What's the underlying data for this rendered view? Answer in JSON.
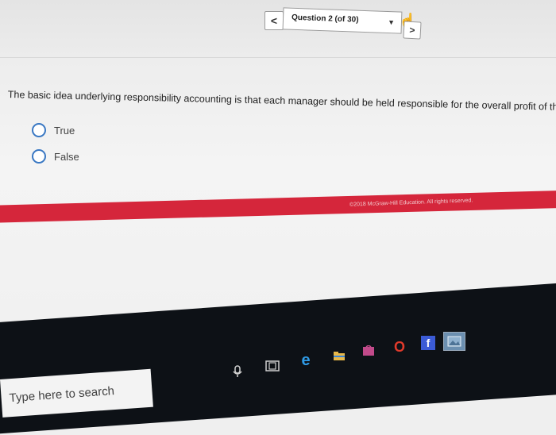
{
  "nav": {
    "prev_label": "<",
    "question_selector": "Question 2 (of 30)",
    "next_label": ">"
  },
  "question": {
    "text": "The basic idea underlying responsibility accounting is that each manager should be held responsible for the overall profit of the company to ens",
    "options": [
      {
        "label": "True"
      },
      {
        "label": "False"
      }
    ]
  },
  "footer": {
    "copyright": "©2018 McGraw-Hill Education. All rights reserved."
  },
  "taskbar": {
    "search_placeholder": "Type here to search",
    "icons": [
      "microphone-icon",
      "task-view-icon",
      "edge-icon",
      "file-explorer-icon",
      "store-icon",
      "opera-icon",
      "facebook-icon",
      "photos-icon"
    ]
  },
  "colors": {
    "accent_red": "#d5263b",
    "radio_blue": "#3a78c3",
    "taskbar_bg": "#0d1116",
    "edge_blue": "#2f9be6",
    "facebook_blue": "#3b5bd6",
    "opera_red": "#e03a2b"
  }
}
